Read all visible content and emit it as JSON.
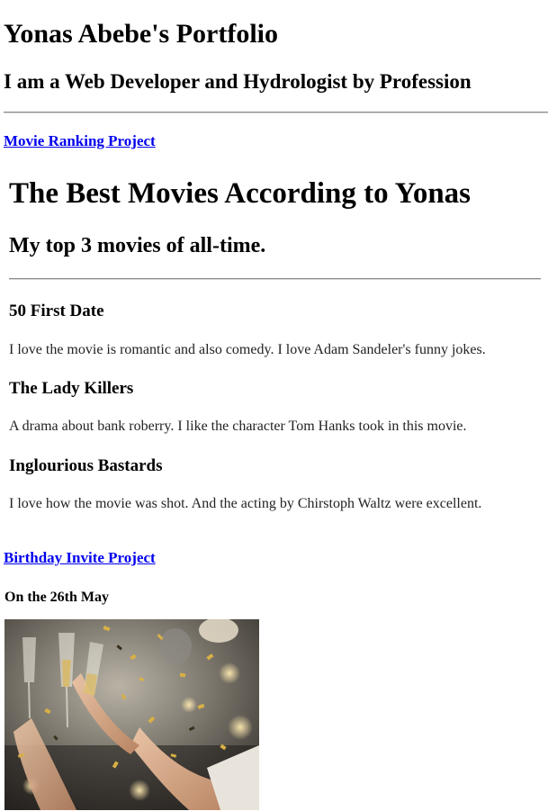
{
  "header": {
    "title": "Yonas Abebe's Portfolio",
    "subtitle": "I am a Web Developer and Hydrologist by Profession"
  },
  "projects": {
    "movie_link": "Movie Ranking Project",
    "birthday_link": "Birthday Invite Project"
  },
  "movie_page": {
    "title": "The Best Movies According to Yonas",
    "subtitle": "My top 3 movies of all-time.",
    "movies": [
      {
        "name": "50 First Date",
        "description": "I love the movie is romantic and also comedy. I love Adam Sandeler's funny jokes."
      },
      {
        "name": "The Lady Killers",
        "description": "A drama about bank roberry. I like the character Tom Hanks took in this movie."
      },
      {
        "name": "Inglourious Bastards",
        "description": "I love how the movie was shot. And the acting by Chirstoph Waltz were excellent."
      }
    ]
  },
  "birthday_invite": {
    "date": "On the 26th May"
  },
  "colors": {
    "link": "#0000ee",
    "rule": "#8a8a8a"
  }
}
